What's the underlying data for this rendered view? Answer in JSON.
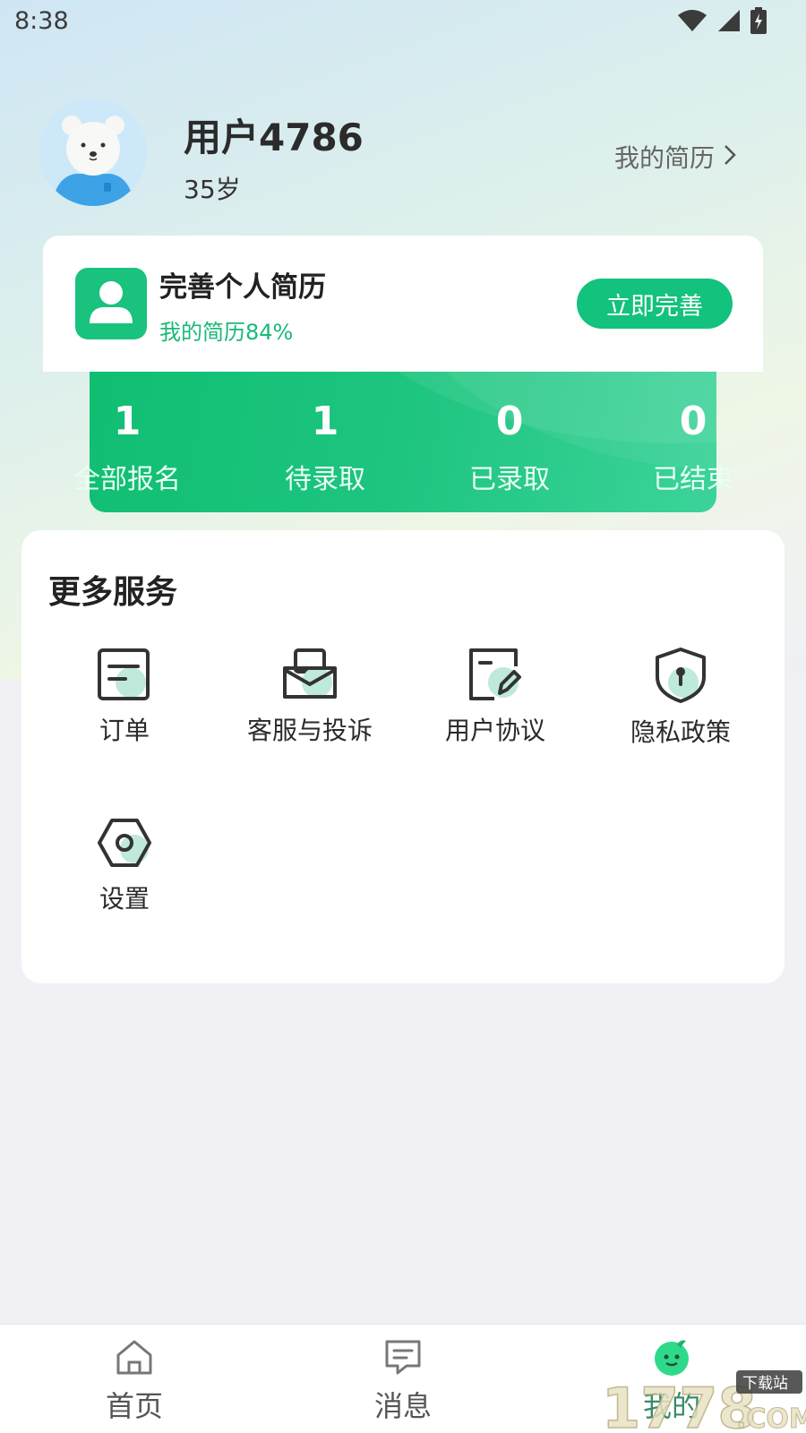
{
  "status_bar": {
    "time": "8:38",
    "icons": [
      "wifi-icon",
      "signal-icon",
      "battery-charging-icon"
    ]
  },
  "profile": {
    "name": "用户4786",
    "age": "35岁",
    "resume_link": "我的简历"
  },
  "resume_card": {
    "title": "完善个人简历",
    "progress": "我的简历84%",
    "progress_value": 0.84,
    "button": "立即完善"
  },
  "stats": [
    {
      "value": "1",
      "label": "全部报名"
    },
    {
      "value": "1",
      "label": "待录取"
    },
    {
      "value": "0",
      "label": "已录取"
    },
    {
      "value": "0",
      "label": "已结束"
    }
  ],
  "services": {
    "title": "更多服务",
    "items": [
      {
        "label": "订单",
        "icon": "order-icon"
      },
      {
        "label": "客服与投诉",
        "icon": "mailbox-icon"
      },
      {
        "label": "用户协议",
        "icon": "agreement-edit-icon"
      },
      {
        "label": "隐私政策",
        "icon": "shield-lock-icon"
      },
      {
        "label": "设置",
        "icon": "settings-hex-icon"
      }
    ]
  },
  "bottom_nav": [
    {
      "label": "首页",
      "icon": "home-icon",
      "active": false
    },
    {
      "label": "消息",
      "icon": "message-icon",
      "active": false
    },
    {
      "label": "我的",
      "icon": "mine-icon",
      "active": true
    }
  ],
  "watermark": {
    "text": "1778",
    "tag": "下载站",
    "suffix": ".COM"
  },
  "colors": {
    "accent": "#13c27c",
    "accent_text": "#19b977",
    "background": "#f0f0f5"
  }
}
